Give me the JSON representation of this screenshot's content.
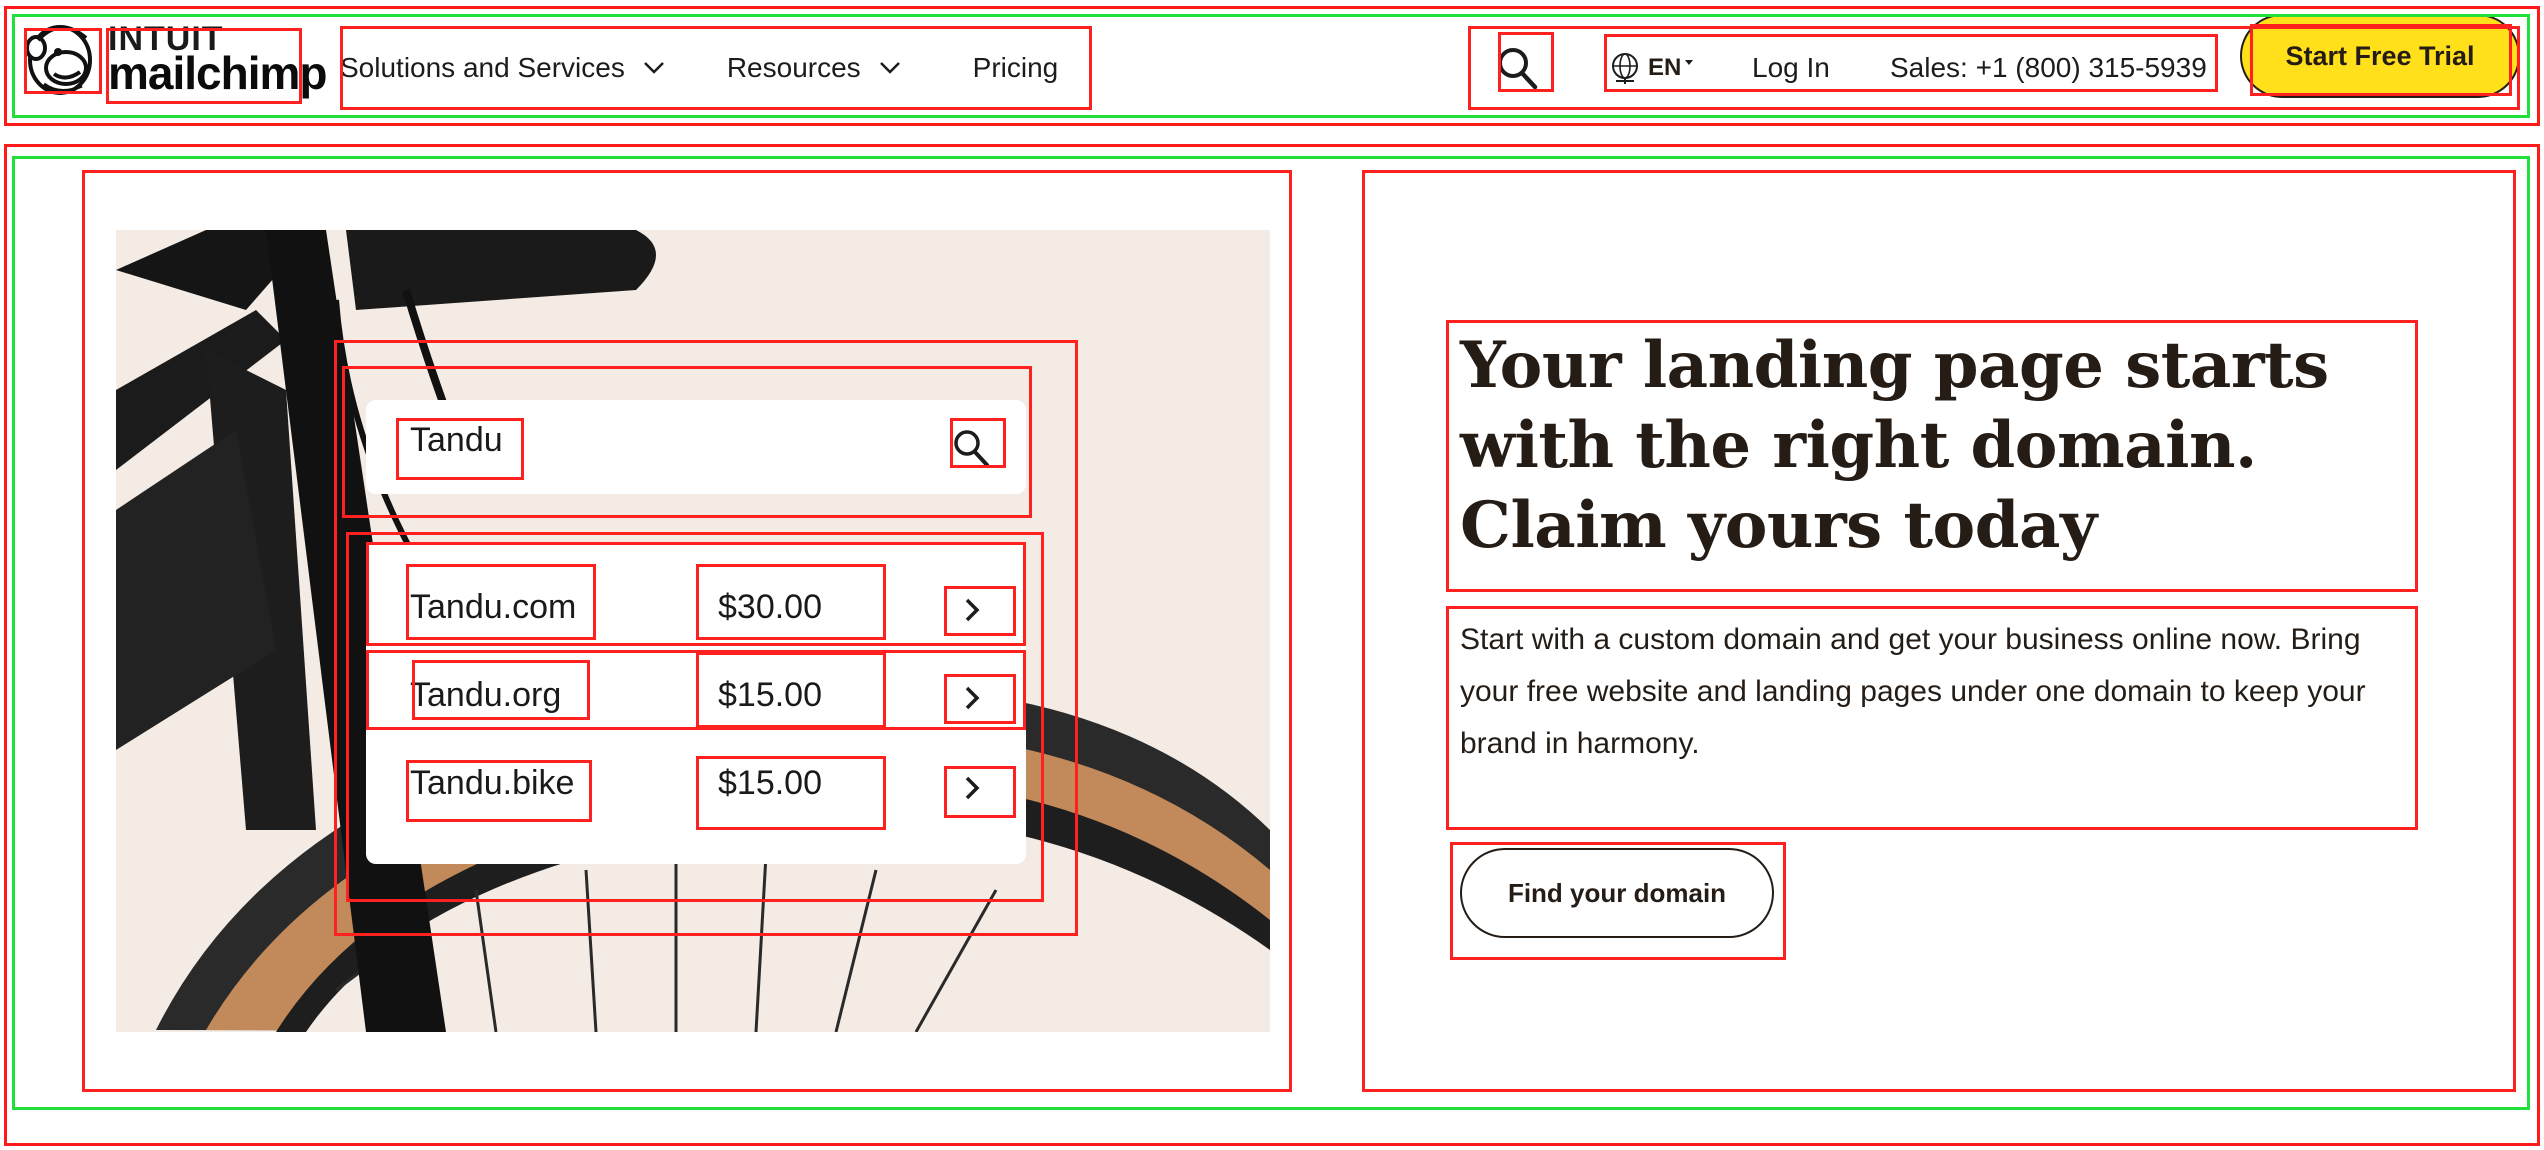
{
  "brand": {
    "name": "Intuit Mailchimp",
    "intuit_text": "INTUIT",
    "mailchimp_text": "mailchimp",
    "accent_yellow": "#ffe01b",
    "text_dark": "#241c15"
  },
  "header": {
    "nav": [
      {
        "label": "Solutions and Services",
        "has_dropdown": true
      },
      {
        "label": "Resources",
        "has_dropdown": true
      },
      {
        "label": "Pricing",
        "has_dropdown": false
      }
    ],
    "search_icon": "search-icon",
    "language": {
      "label": "EN",
      "icon": "globe-icon"
    },
    "login_label": "Log In",
    "sales_label": "Sales: +1 (800) 315-5939",
    "trial_label": "Start Free Trial"
  },
  "hero": {
    "illustration": {
      "search_value": "Tandu",
      "results": [
        {
          "domain": "Tandu.com",
          "price": "$30.00"
        },
        {
          "domain": "Tandu.org",
          "price": "$15.00"
        },
        {
          "domain": "Tandu.bike",
          "price": "$15.00"
        }
      ]
    },
    "headline": "Your landing page starts with the right domain. Claim yours today",
    "body": "Start with a custom domain and get your business online now. Bring your free website and landing pages under one domain to keep your brand in harmony.",
    "cta_label": "Find your domain"
  }
}
